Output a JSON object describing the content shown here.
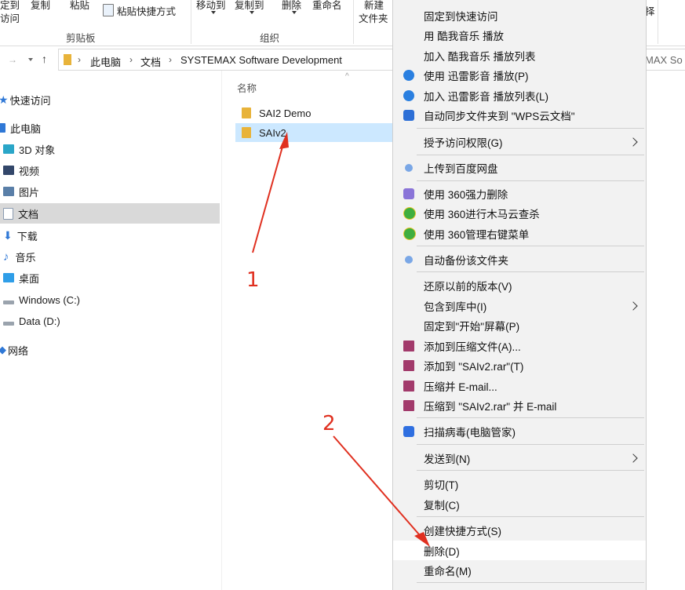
{
  "ribbon": {
    "pin_top": "定到",
    "pin_bottom": "访问",
    "copy": "复制",
    "paste": "粘贴",
    "paste_shortcut": "粘贴快捷方式",
    "move_to": "移动到",
    "copy_to": "复制到",
    "delete": "删除",
    "rename": "重命名",
    "new_top": "新建",
    "new_folder": "文件夹",
    "clipboard_group": "剪贴板",
    "organize_group": "组织",
    "right_char": "择"
  },
  "address": {
    "segments": [
      "此电脑",
      "文档",
      "SYSTEMAX Software Development"
    ],
    "right_overflow": "MAX So"
  },
  "nav": {
    "items": [
      {
        "label": "快速访问",
        "icon": "star-icon"
      },
      {
        "label": "此电脑",
        "icon": "computer-icon"
      },
      {
        "label": "3D 对象",
        "icon": "cube-icon"
      },
      {
        "label": "视频",
        "icon": "film-icon"
      },
      {
        "label": "图片",
        "icon": "picture-icon"
      },
      {
        "label": "文档",
        "icon": "document-icon"
      },
      {
        "label": "下载",
        "icon": "download-icon"
      },
      {
        "label": "音乐",
        "icon": "music-icon"
      },
      {
        "label": "桌面",
        "icon": "desktop-icon"
      },
      {
        "label": "Windows (C:)",
        "icon": "drive-icon"
      },
      {
        "label": "Data (D:)",
        "icon": "drive-icon"
      },
      {
        "label": "网络",
        "icon": "network-icon"
      }
    ]
  },
  "filelist": {
    "column_name": "名称",
    "files": [
      "SAI2 Demo",
      "SAIv2"
    ]
  },
  "menu": {
    "items": [
      {
        "label": "固定到快速访问"
      },
      {
        "label": "用 酷我音乐 播放"
      },
      {
        "label": "加入 酷我音乐 播放列表"
      },
      {
        "label": "使用 迅雷影音 播放(P)",
        "icon": "xunlei-icon",
        "color": "#2a7fe0"
      },
      {
        "label": "加入 迅雷影音 播放列表(L)",
        "icon": "xunlei-icon",
        "color": "#2a7fe0"
      },
      {
        "label": "自动同步文件夹到 \"WPS云文档\"",
        "icon": "wps-cloud-icon",
        "color": "#2d6fd6"
      },
      {
        "label": "授予访问权限(G)"
      },
      {
        "label": "上传到百度网盘",
        "icon": "baidu-icon",
        "color": "#7aa7e6"
      },
      {
        "label": "使用 360强力删除",
        "icon": "360-delete-icon",
        "color": "#8a74d8"
      },
      {
        "label": "使用 360进行木马云查杀",
        "icon": "360-scan-icon",
        "color": "#3fae3f"
      },
      {
        "label": "使用 360管理右键菜单",
        "icon": "360-menu-icon",
        "color": "#3fae3f"
      },
      {
        "label": "自动备份该文件夹",
        "icon": "backup-icon",
        "color": "#7aa7e6"
      },
      {
        "label": "还原以前的版本(V)"
      },
      {
        "label": "包含到库中(I)"
      },
      {
        "label": "固定到\"开始\"屏幕(P)"
      },
      {
        "label": "添加到压缩文件(A)...",
        "icon": "winrar-icon",
        "color": "#a23a6b"
      },
      {
        "label": "添加到 \"SAIv2.rar\"(T)",
        "icon": "winrar-icon",
        "color": "#a23a6b"
      },
      {
        "label": "压缩并 E-mail...",
        "icon": "winrar-icon",
        "color": "#a23a6b"
      },
      {
        "label": "压缩到 \"SAIv2.rar\" 并 E-mail",
        "icon": "winrar-icon",
        "color": "#a23a6b"
      },
      {
        "label": "扫描病毒(电脑管家)",
        "icon": "tencent-shield-icon",
        "color": "#2f6fe0"
      },
      {
        "label": "发送到(N)"
      },
      {
        "label": "剪切(T)"
      },
      {
        "label": "复制(C)"
      },
      {
        "label": "创建快捷方式(S)"
      },
      {
        "label": "删除(D)"
      },
      {
        "label": "重命名(M)"
      }
    ]
  },
  "annotations": {
    "step1": "1",
    "step2": "2"
  }
}
